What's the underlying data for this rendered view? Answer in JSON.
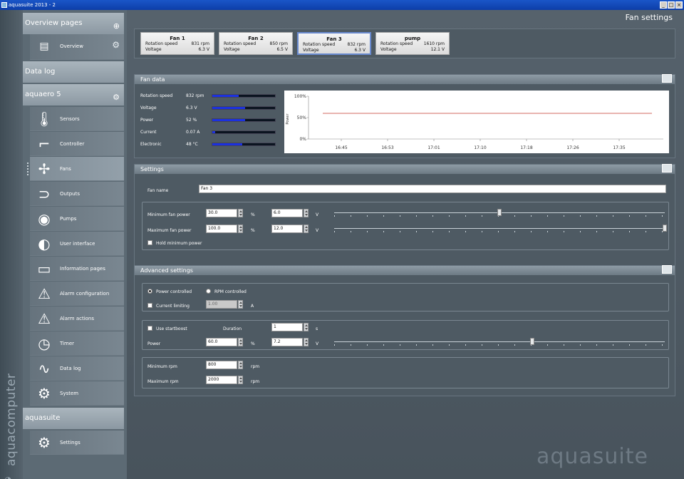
{
  "window": {
    "title": "aquasuite 2013 - 2",
    "buttons": [
      "_",
      "□",
      "×"
    ]
  },
  "brand": {
    "vertical": "aquacomputer",
    "main": "aquasuite"
  },
  "sidebar": {
    "overview_header": "Overview pages",
    "overview_item": "Overview",
    "datalog_header": "Data log",
    "device_header": "aquaero 5",
    "items": [
      {
        "label": "Sensors",
        "icon": "thermometer-icon"
      },
      {
        "label": "Controller",
        "icon": "controller-icon"
      },
      {
        "label": "Fans",
        "icon": "fan-icon"
      },
      {
        "label": "Outputs",
        "icon": "outputs-icon"
      },
      {
        "label": "Pumps",
        "icon": "pump-icon"
      },
      {
        "label": "User interface",
        "icon": "user-interface-icon"
      },
      {
        "label": "Information pages",
        "icon": "pages-icon"
      },
      {
        "label": "Alarm configuration",
        "icon": "alarm-icon"
      },
      {
        "label": "Alarm actions",
        "icon": "alarm-actions-icon"
      },
      {
        "label": "Timer",
        "icon": "clock-icon"
      },
      {
        "label": "Data log",
        "icon": "chart-icon"
      },
      {
        "label": "System",
        "icon": "gears-icon"
      }
    ],
    "aquasuite_header": "aquasuite",
    "settings_item": "Settings"
  },
  "main": {
    "title": "Fan settings"
  },
  "fans": [
    {
      "name": "Fan 1",
      "speed_label": "Rotation speed",
      "speed": "831 rpm",
      "voltage_label": "Voltage",
      "voltage": "6.3 V"
    },
    {
      "name": "Fan 2",
      "speed_label": "Rotation speed",
      "speed": "850 rpm",
      "voltage_label": "Voltage",
      "voltage": "6.5 V"
    },
    {
      "name": "Fan 3",
      "speed_label": "Rotation speed",
      "speed": "832 rpm",
      "voltage_label": "Voltage",
      "voltage": "6.3 V"
    },
    {
      "name": "pump",
      "speed_label": "Rotation speed",
      "speed": "1610 rpm",
      "voltage_label": "Voltage",
      "voltage": "12.1 V"
    }
  ],
  "fan_data": {
    "title": "Fan data",
    "rows": [
      {
        "label": "Rotation speed",
        "value": "832 rpm",
        "level": 0.42
      },
      {
        "label": "Voltage",
        "value": "6.3 V",
        "level": 0.52
      },
      {
        "label": "Power",
        "value": "52 %",
        "level": 0.52
      },
      {
        "label": "Current",
        "value": "0.07 A",
        "level": 0.04
      },
      {
        "label": "Electronic",
        "value": "48 °C",
        "level": 0.48
      }
    ]
  },
  "chart_data": {
    "type": "line",
    "ylabel": "Power",
    "y_ticks": [
      "100%",
      "50%",
      "0%"
    ],
    "ylim": [
      0,
      100
    ],
    "x_ticks": [
      "16:45",
      "16:53",
      "17:01",
      "17:10",
      "17:18",
      "17:26",
      "17:35"
    ],
    "series": [
      {
        "values": [
          60,
          60,
          60,
          60,
          60,
          60,
          60,
          60
        ],
        "color": "#c0392b"
      }
    ]
  },
  "settings": {
    "title": "Settings",
    "fan_name_label": "Fan name",
    "fan_name": "Fan 3",
    "min_power_label": "Minimum fan power",
    "min_power": "30.0",
    "min_voltage": "6.0",
    "min_slider_level": 0.5,
    "max_power_label": "Maximum fan power",
    "max_power": "100.0",
    "max_voltage": "12.0",
    "max_slider_level": 1.0,
    "percent_unit": "%",
    "volt_unit": "V",
    "hold_min_label": "Hold minimum power"
  },
  "advanced": {
    "title": "Advanced settings",
    "power_controlled": "Power controlled",
    "rpm_controlled": "RPM controlled",
    "current_limiting": "Current limiting",
    "current_value": "1.00",
    "amp_unit": "A",
    "startboost": "Use startboost",
    "duration_label": "Duration",
    "duration": "1",
    "seconds_unit": "s",
    "power_label": "Power",
    "power": "60.0",
    "power_voltage": "7.2",
    "power_slider_level": 0.6,
    "min_rpm_label": "Minimum rpm",
    "min_rpm": "800",
    "max_rpm_label": "Maximum rpm",
    "max_rpm": "2000",
    "rpm_unit": "rpm"
  }
}
